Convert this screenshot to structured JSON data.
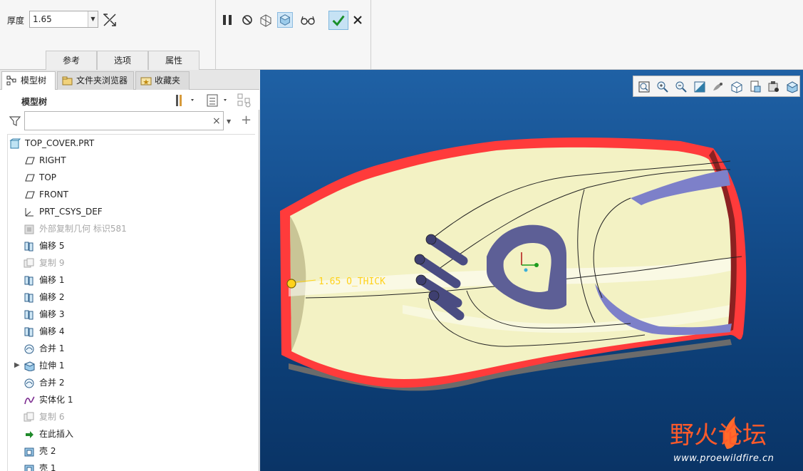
{
  "dashboard": {
    "thickness_label": "厚度",
    "thickness_value": "1.65",
    "tabs": [
      "参考",
      "选项",
      "属性"
    ],
    "controls": [
      "pause-icon",
      "no-preview-icon",
      "preview-geometry-icon",
      "verify-view-icon",
      "glasses-icon"
    ],
    "ok": "check-icon",
    "cancel": "close-icon"
  },
  "nav_tabs": [
    {
      "label": "模型树",
      "icon": "model-tree-icon",
      "active": true
    },
    {
      "label": "文件夹浏览器",
      "icon": "folder-browser-icon",
      "active": false
    },
    {
      "label": "收藏夹",
      "icon": "favorites-icon",
      "active": false
    }
  ],
  "tree_header": {
    "title": "模型树"
  },
  "filter": {
    "placeholder": "",
    "value": ""
  },
  "tree": [
    {
      "label": "TOP_COVER.PRT",
      "icon": "part-icon",
      "indent": 0,
      "dim": false
    },
    {
      "label": "RIGHT",
      "icon": "datum-plane-icon",
      "indent": 1,
      "dim": false
    },
    {
      "label": "TOP",
      "icon": "datum-plane-icon",
      "indent": 1,
      "dim": false
    },
    {
      "label": "FRONT",
      "icon": "datum-plane-icon",
      "indent": 1,
      "dim": false
    },
    {
      "label": "PRT_CSYS_DEF",
      "icon": "csys-icon",
      "indent": 1,
      "dim": false
    },
    {
      "label": "外部复制几何 标识581",
      "icon": "external-copy-icon",
      "indent": 1,
      "dim": true
    },
    {
      "label": "偏移 5",
      "icon": "offset-icon",
      "indent": 1,
      "dim": false
    },
    {
      "label": "复制 9",
      "icon": "copy-icon",
      "indent": 1,
      "dim": true
    },
    {
      "label": "偏移 1",
      "icon": "offset-icon",
      "indent": 1,
      "dim": false
    },
    {
      "label": "偏移 2",
      "icon": "offset-icon",
      "indent": 1,
      "dim": false
    },
    {
      "label": "偏移 3",
      "icon": "offset-icon",
      "indent": 1,
      "dim": false
    },
    {
      "label": "偏移 4",
      "icon": "offset-icon",
      "indent": 1,
      "dim": false
    },
    {
      "label": "合并 1",
      "icon": "merge-icon",
      "indent": 1,
      "dim": false
    },
    {
      "label": "拉伸 1",
      "icon": "extrude-icon",
      "indent": 1,
      "dim": false,
      "expandable": true
    },
    {
      "label": "合并 2",
      "icon": "merge-icon",
      "indent": 1,
      "dim": false
    },
    {
      "label": "实体化 1",
      "icon": "solidify-icon",
      "indent": 1,
      "dim": false
    },
    {
      "label": "复制 6",
      "icon": "copy-icon",
      "indent": 1,
      "dim": true
    },
    {
      "label": "在此插入",
      "icon": "insert-here-icon",
      "indent": 1,
      "dim": false
    },
    {
      "label": "壳 2",
      "icon": "shell-icon",
      "indent": 1,
      "dim": false
    },
    {
      "label": "壳 1",
      "icon": "shell-icon",
      "indent": 1,
      "dim": false
    }
  ],
  "viewport": {
    "dimension_label": "1.65 O_THICK",
    "watermark_brand": "野火论坛",
    "watermark_url": "www.proewildfire.cn",
    "colors": {
      "shell_edge": "#ff3b3b",
      "surface": "#f3f2c4",
      "cut": "#7d80c9",
      "background_top": "#1f61a5",
      "background_bottom": "#0a3466"
    }
  },
  "view_toolbar": [
    "refit-icon",
    "zoom-in-icon",
    "zoom-out-icon",
    "repaint-icon",
    "display-style-icon",
    "saved-views-icon",
    "view-manager-icon",
    "perspective-icon",
    "appearance-icon"
  ]
}
